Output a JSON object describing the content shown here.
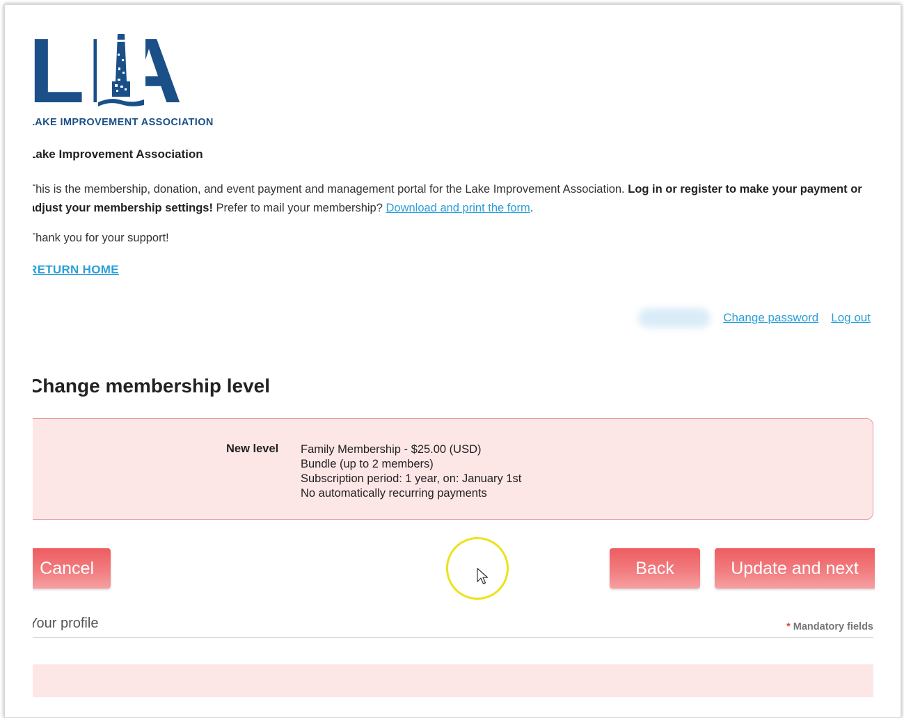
{
  "logo": {
    "letters": "LIA",
    "tagline": "LAKE IMPROVEMENT ASSOCIATION",
    "brand_color": "#1b4f87"
  },
  "org": {
    "title": "Lake Improvement Association"
  },
  "intro": {
    "text_1": "This is the membership, donation, and event payment and management portal for the Lake Improvement Association. ",
    "bold": "Log in or register to make your payment or adjust your membership settings!",
    "text_2": " Prefer to mail your membership? ",
    "link": "Download and print the form",
    "text_3": "."
  },
  "thanks": "Thank you for your support!",
  "return_home": "RETURN HOME",
  "user_bar": {
    "change_password": "Change password",
    "log_out": "Log out"
  },
  "page_title": "Change membership level",
  "level": {
    "label": "New level",
    "line_1": "Family Membership - $25.00 (USD)",
    "line_2": "Bundle (up to 2 members)",
    "line_3": "Subscription period: 1 year, on: January 1st",
    "line_4": "No automatically recurring payments"
  },
  "buttons": {
    "cancel": "Cancel",
    "back": "Back",
    "update_next": "Update and next"
  },
  "profile": {
    "title": "Your profile",
    "mandatory_star": "*",
    "mandatory": "Mandatory fields"
  },
  "colors": {
    "accent_link": "#2a9fd8",
    "button": "#f06e72",
    "panel_bg": "#fde6e6",
    "cursor_highlight": "#ede21c"
  }
}
